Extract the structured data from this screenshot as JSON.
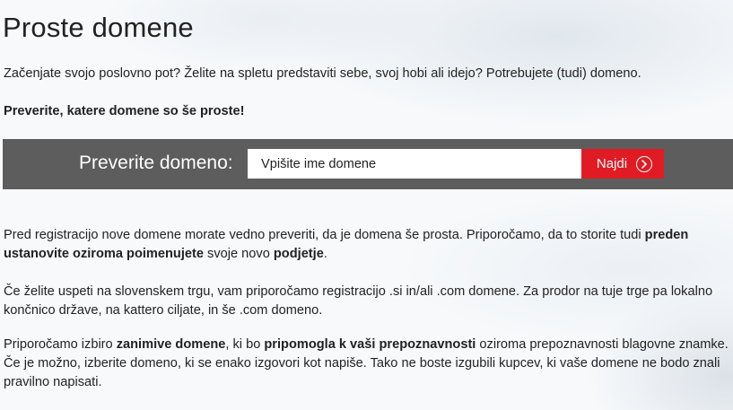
{
  "page": {
    "title": "Proste domene",
    "intro": "Začenjate svojo poslovno pot? Želite na spletu predstaviti sebe, svoj hobi ali idejo? Potrebujete (tudi) domeno.",
    "check_heading": "Preverite, katere domene so še proste!"
  },
  "search": {
    "label": "Preverite domeno:",
    "placeholder": "Vpišite ime domene",
    "button_label": "Najdi",
    "button_icon": "chevron-right-circle-icon"
  },
  "paragraphs": {
    "p1": {
      "t1": "Pred registracijo nove domene morate vedno preveriti, da je domena še prosta. Priporočamo, da to storite tudi ",
      "b1": "preden ustanovite oziroma poimenujete",
      "t2": " svoje novo ",
      "b2": "podjetje",
      "t3": "."
    },
    "p2": {
      "t1": "Če želite uspeti na slovenskem trgu, vam priporočamo registracijo .si in/ali .com domene. Za prodor na tuje trge pa lokalno končnico države, na kattero ciljate, in še .com domeno."
    },
    "p3": {
      "t1": "Priporočamo izbiro ",
      "b1": "zanimive domene",
      "t2": ", ki bo ",
      "b2": "pripomogla k vaši prepoznavnosti",
      "t3": " oziroma prepoznavnosti blagovne znamke. Če je možno, izberite domeno, ki se enako izgovori kot napiše. Tako ne boste izgubili kupcev, ki vaše domene ne bodo znali pravilno napisati."
    }
  },
  "colors": {
    "search_bar_bg": "#5d5d5d",
    "button_bg": "#e01b24",
    "text": "#222222"
  }
}
